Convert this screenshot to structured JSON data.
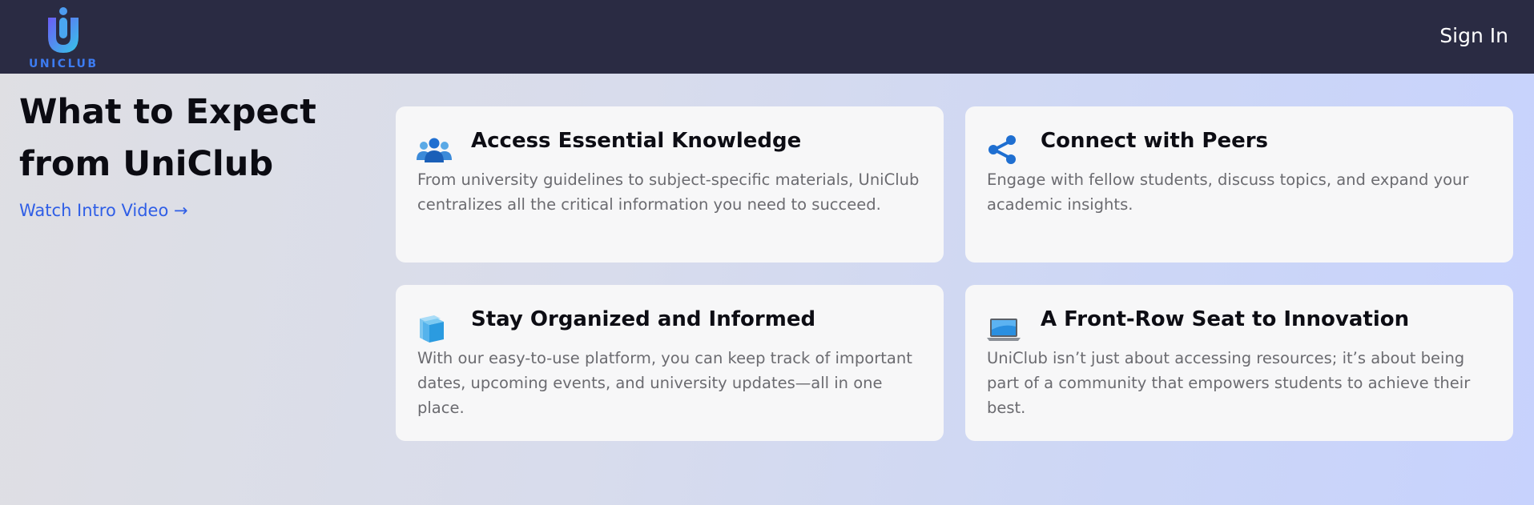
{
  "header": {
    "logo_text": "UNICLUB",
    "signin_label": "Sign In"
  },
  "intro": {
    "heading": "What to Expect from UniClub",
    "watch_link": "Watch Intro Video →"
  },
  "cards": [
    {
      "icon": "people-icon",
      "title": "Access Essential Knowledge",
      "body": "From university guidelines to subject-specific materials, UniClub centralizes all the critical information you need to succeed."
    },
    {
      "icon": "share-icon",
      "title": "Connect with Peers",
      "body": "Engage with fellow students, discuss topics, and expand your academic insights."
    },
    {
      "icon": "stacked-files-icon",
      "title": "Stay Organized and Informed",
      "body": "With our easy-to-use platform, you can keep track of important dates, upcoming events, and university updates—all in one place."
    },
    {
      "icon": "laptop-icon",
      "title": "A Front-Row Seat to Innovation",
      "body": "UniClub isn’t just about accessing resources; it’s about being part of a community that empowers students to achieve their best."
    }
  ],
  "colors": {
    "header_bg": "#2a2b43",
    "link": "#2f5ee6",
    "logo_gradient_start": "#6b5cf5",
    "logo_gradient_end": "#35c7e8"
  }
}
